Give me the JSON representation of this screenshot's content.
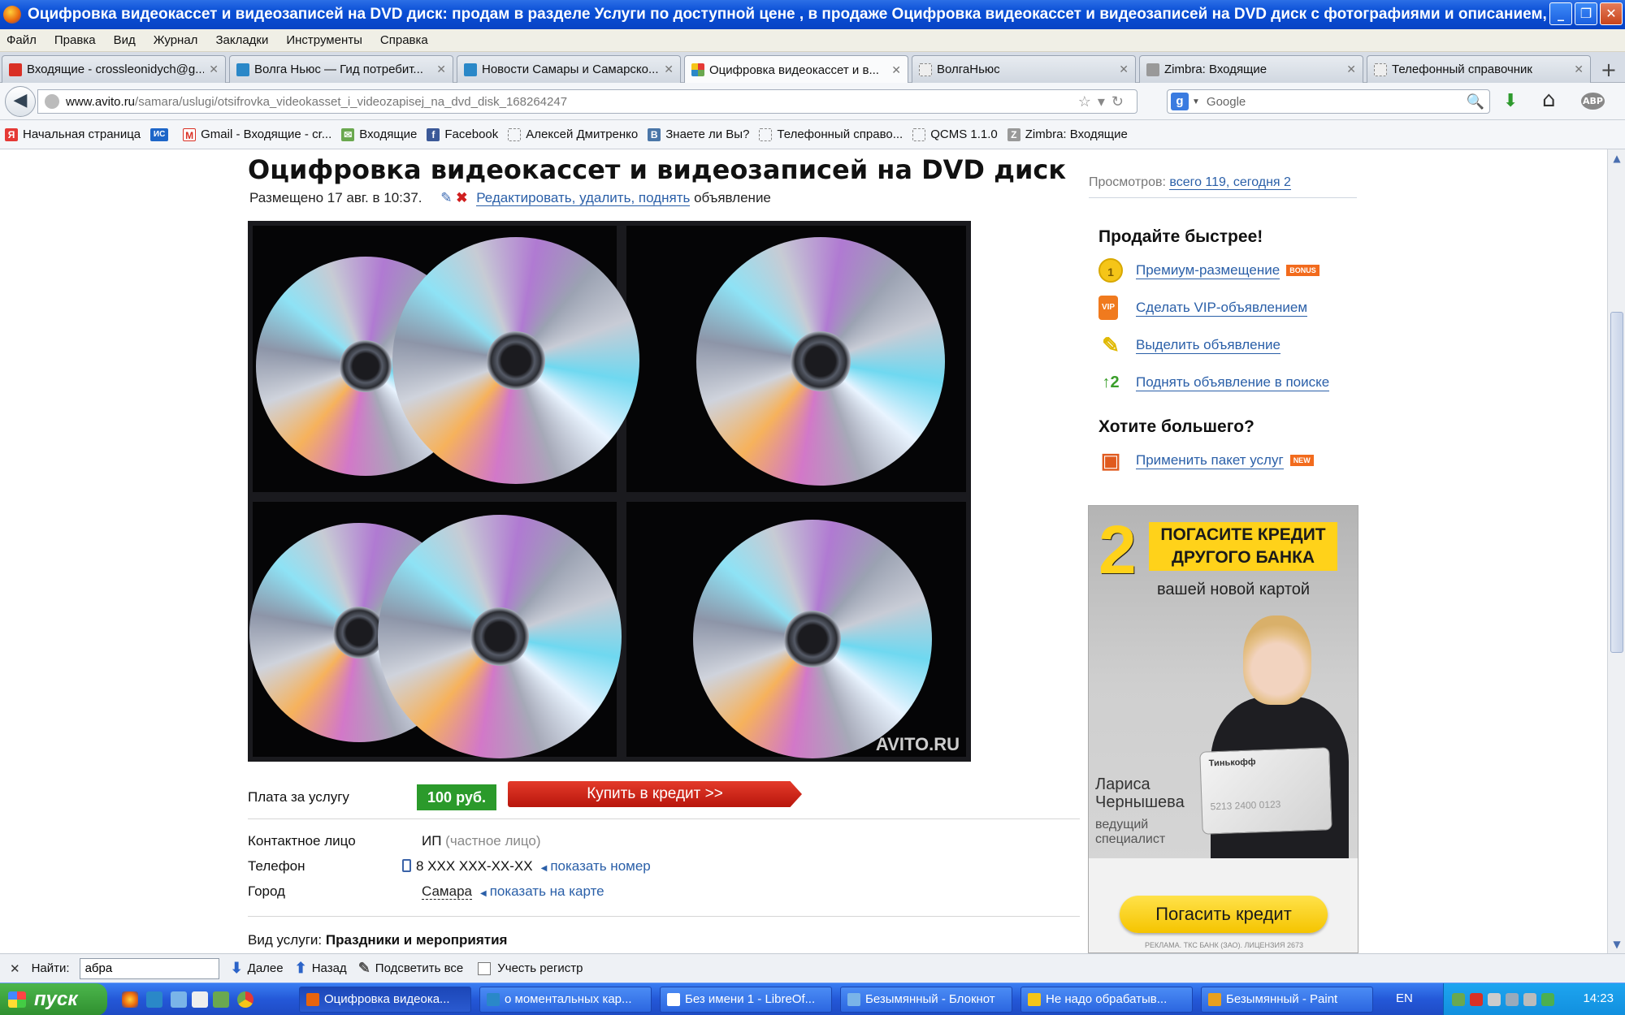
{
  "window": {
    "title": "Оцифровка видеокассет и видеозаписей на DVD диск: продам в разделе Услуги по доступной цене , в продаже Оцифровка видеокассет и видеозаписей на DVD диск с фотографиями и описанием, … - Бесп...",
    "btn_min": "_",
    "btn_max": "❐",
    "btn_close": "✕"
  },
  "menu": [
    "Файл",
    "Правка",
    "Вид",
    "Журнал",
    "Закладки",
    "Инструменты",
    "Справка"
  ],
  "tabs": [
    {
      "label": "Входящие - crossleonidych@g...",
      "icon_color": "#d93025"
    },
    {
      "label": "Волга Ньюс — Гид потребит...",
      "icon_color": "#2a88c8"
    },
    {
      "label": "Новости Самары и Самарско...",
      "icon_color": "#2a88c8"
    },
    {
      "label": "Оцифровка видеокассет и в...",
      "icon_color": "#6aa84f"
    },
    {
      "label": "ВолгаНьюс",
      "icon_color": "#cccccc"
    },
    {
      "label": "Zimbra: Входящие",
      "icon_color": "#999999"
    },
    {
      "label": "Телефонный справочник",
      "icon_color": "#cccccc"
    }
  ],
  "tab_close": "✕",
  "new_tab": "+",
  "nav": {
    "back": "◀",
    "url_host": "www.avito.ru",
    "url_path": "/samara/uslugi/otsifrovka_videokasset_i_videozapisej_na_dvd_disk_168264247",
    "url_icons": "☆▾↻",
    "search_engine": "g",
    "search_placeholder": "Google",
    "search_icon": "🔍",
    "download_icon": "⬇",
    "home_icon": "⌂",
    "addon_icon": "ABP"
  },
  "bookmarks": [
    {
      "label": "Начальная страница",
      "icon": "Я",
      "color": "#e53935"
    },
    {
      "label": "",
      "icon": "ИС",
      "color": "#1e66c8"
    },
    {
      "label": "Gmail - Входящие - cr...",
      "icon": "M",
      "color": "#d93025"
    },
    {
      "label": "Входящие",
      "icon": "✉",
      "color": "#6aa84f"
    },
    {
      "label": "Facebook",
      "icon": "f",
      "color": "#3b5998"
    },
    {
      "label": "Алексей Дмитренко",
      "icon": "",
      "color": "#cccccc"
    },
    {
      "label": "Знаете ли Вы?",
      "icon": "B",
      "color": "#4a76a8"
    },
    {
      "label": "Телефонный справо...",
      "icon": "",
      "color": "#cccccc"
    },
    {
      "label": "QCMS 1.1.0",
      "icon": "",
      "color": "#cccccc"
    },
    {
      "label": "Zimbra: Входящие",
      "icon": "Z",
      "color": "#999999"
    }
  ],
  "ad": {
    "title": "Оцифровка видеокассет и видеозаписей на DVD диск",
    "posted": "Размещено 17 авг. в 10:37.",
    "pencil_icon": "✎",
    "delete_icon": "✖",
    "edit_link": "Редактировать, удалить, поднять",
    "edit_suffix": "объявление",
    "watermark": "AVITO.RU",
    "price_label": "Плата за услугу",
    "price": "100 руб.",
    "credit_button": "Купить в кредит >>",
    "contact_label": "Контактное лицо",
    "contact_value": "ИП",
    "contact_type": "(частное лицо)",
    "phone_label": "Телефон",
    "phone_value": "8 XXX XXX-XX-XX",
    "phone_link": "показать номер",
    "city_label": "Город",
    "city_value": "Самара",
    "map_link": "показать на карте",
    "service_label": "Вид услуги:",
    "service_value": "Праздники и мероприятия"
  },
  "sidebar": {
    "views_label": "Просмотров:",
    "views_value": "всего 119, сегодня 2",
    "sell_heading": "Продайте быстрее!",
    "promos": [
      {
        "label": "Премиум-размещение",
        "tag": "BONUS",
        "icon": "1",
        "color": "#f5c518"
      },
      {
        "label": "Сделать VIP-объявлением",
        "tag": "",
        "icon": "VIP",
        "color": "#f07a1e"
      },
      {
        "label": "Выделить объявление",
        "tag": "",
        "icon": "✎",
        "color": "#f5d020"
      },
      {
        "label": "Поднять объявление в поиске",
        "tag": "",
        "icon": "↑2",
        "color": "#4cae3a"
      }
    ],
    "more_heading": "Хотите большего?",
    "package_label": "Применить пакет услуг",
    "package_tag": "NEW",
    "package_icon": "▣"
  },
  "banner": {
    "number": "2",
    "headline_1": "ПОГАСИТЕ КРЕДИТ",
    "headline_2": "ДРУГОГО БАНКА",
    "subline": "вашей новой картой",
    "card_brand": "Тинькофф",
    "card_number": "5213 2400 0123",
    "person_name_1": "Лариса",
    "person_name_2": "Чернышева",
    "person_role_1": "ведущий",
    "person_role_2": "специалист",
    "cta": "Погасить кредит",
    "fine_print": "РЕКЛАМА. ТКС БАНК (ЗАО). ЛИЦЕНЗИЯ 2673"
  },
  "findbar": {
    "close": "✕",
    "label": "Найти:",
    "query": "абра",
    "next": "Далее",
    "prev": "Назад",
    "highlight": "Подсветить все",
    "match_case": "Учесть регистр"
  },
  "taskbar": {
    "start": "пуск",
    "tasks": [
      {
        "label": "Оцифровка видеока...",
        "color": "#e8640c"
      },
      {
        "label": "о моментальных кар...",
        "color": "#2a88c8"
      },
      {
        "label": "Без имени 1 - LibreOf...",
        "color": "#ffffff"
      },
      {
        "label": "Безымянный - Блокнот",
        "color": "#7ab4e8"
      },
      {
        "label": "Не надо обрабатыв...",
        "color": "#f5c518"
      },
      {
        "label": "Безымянный - Paint",
        "color": "#e8a020"
      }
    ],
    "lang": "EN",
    "clock": "14:23"
  }
}
